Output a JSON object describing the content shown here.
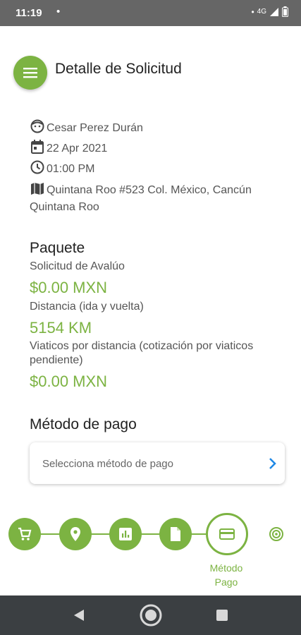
{
  "status_bar": {
    "time": "11:19",
    "notification_dot": "•",
    "network": "4G"
  },
  "header": {
    "title": "Detalle de Solicitud"
  },
  "details": {
    "client_name": "Cesar Perez Durán",
    "date": "22 Apr 2021",
    "time": "01:00 PM",
    "address_line1": "Quintana Roo #523 Col. México, Cancún",
    "address_line2": "Quintana Roo"
  },
  "package": {
    "title": "Paquete",
    "items": [
      {
        "label": "Solicitud de Avalúo",
        "value": "$0.00 MXN"
      },
      {
        "label": "Distancia (ida y vuelta)",
        "value": "5154 KM"
      },
      {
        "label_line1": "Viaticos por distancia (cotización por viaticos",
        "label_line2": "pendiente)",
        "value": "$0.00 MXN"
      }
    ]
  },
  "payment": {
    "title": "Método de pago",
    "select_placeholder": "Selecciona método de pago"
  },
  "stepper": {
    "steps": [
      "cart-icon",
      "location-pin-icon",
      "chart-icon",
      "document-icon",
      "credit-card-icon",
      "radar-icon"
    ],
    "active_label_line1": "Método",
    "active_label_line2": "Pago"
  },
  "colors": {
    "accent": "#7cb342",
    "status_bar": "#666666",
    "nav_bar": "#3b3f42",
    "chevron": "#1e88e5"
  }
}
